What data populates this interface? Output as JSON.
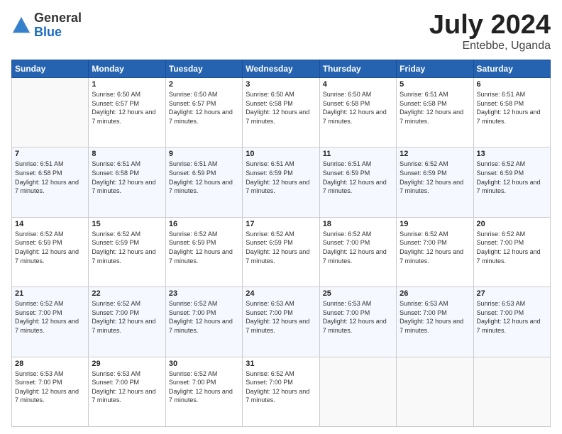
{
  "logo": {
    "general": "General",
    "blue": "Blue"
  },
  "header": {
    "month": "July 2024",
    "location": "Entebbe, Uganda"
  },
  "weekdays": [
    "Sunday",
    "Monday",
    "Tuesday",
    "Wednesday",
    "Thursday",
    "Friday",
    "Saturday"
  ],
  "weeks": [
    [
      {
        "day": "",
        "sunrise": "",
        "sunset": "",
        "daylight": ""
      },
      {
        "day": "1",
        "sunrise": "Sunrise: 6:50 AM",
        "sunset": "Sunset: 6:57 PM",
        "daylight": "Daylight: 12 hours and 7 minutes."
      },
      {
        "day": "2",
        "sunrise": "Sunrise: 6:50 AM",
        "sunset": "Sunset: 6:57 PM",
        "daylight": "Daylight: 12 hours and 7 minutes."
      },
      {
        "day": "3",
        "sunrise": "Sunrise: 6:50 AM",
        "sunset": "Sunset: 6:58 PM",
        "daylight": "Daylight: 12 hours and 7 minutes."
      },
      {
        "day": "4",
        "sunrise": "Sunrise: 6:50 AM",
        "sunset": "Sunset: 6:58 PM",
        "daylight": "Daylight: 12 hours and 7 minutes."
      },
      {
        "day": "5",
        "sunrise": "Sunrise: 6:51 AM",
        "sunset": "Sunset: 6:58 PM",
        "daylight": "Daylight: 12 hours and 7 minutes."
      },
      {
        "day": "6",
        "sunrise": "Sunrise: 6:51 AM",
        "sunset": "Sunset: 6:58 PM",
        "daylight": "Daylight: 12 hours and 7 minutes."
      }
    ],
    [
      {
        "day": "7",
        "sunrise": "Sunrise: 6:51 AM",
        "sunset": "Sunset: 6:58 PM",
        "daylight": "Daylight: 12 hours and 7 minutes."
      },
      {
        "day": "8",
        "sunrise": "Sunrise: 6:51 AM",
        "sunset": "Sunset: 6:58 PM",
        "daylight": "Daylight: 12 hours and 7 minutes."
      },
      {
        "day": "9",
        "sunrise": "Sunrise: 6:51 AM",
        "sunset": "Sunset: 6:59 PM",
        "daylight": "Daylight: 12 hours and 7 minutes."
      },
      {
        "day": "10",
        "sunrise": "Sunrise: 6:51 AM",
        "sunset": "Sunset: 6:59 PM",
        "daylight": "Daylight: 12 hours and 7 minutes."
      },
      {
        "day": "11",
        "sunrise": "Sunrise: 6:51 AM",
        "sunset": "Sunset: 6:59 PM",
        "daylight": "Daylight: 12 hours and 7 minutes."
      },
      {
        "day": "12",
        "sunrise": "Sunrise: 6:52 AM",
        "sunset": "Sunset: 6:59 PM",
        "daylight": "Daylight: 12 hours and 7 minutes."
      },
      {
        "day": "13",
        "sunrise": "Sunrise: 6:52 AM",
        "sunset": "Sunset: 6:59 PM",
        "daylight": "Daylight: 12 hours and 7 minutes."
      }
    ],
    [
      {
        "day": "14",
        "sunrise": "Sunrise: 6:52 AM",
        "sunset": "Sunset: 6:59 PM",
        "daylight": "Daylight: 12 hours and 7 minutes."
      },
      {
        "day": "15",
        "sunrise": "Sunrise: 6:52 AM",
        "sunset": "Sunset: 6:59 PM",
        "daylight": "Daylight: 12 hours and 7 minutes."
      },
      {
        "day": "16",
        "sunrise": "Sunrise: 6:52 AM",
        "sunset": "Sunset: 6:59 PM",
        "daylight": "Daylight: 12 hours and 7 minutes."
      },
      {
        "day": "17",
        "sunrise": "Sunrise: 6:52 AM",
        "sunset": "Sunset: 6:59 PM",
        "daylight": "Daylight: 12 hours and 7 minutes."
      },
      {
        "day": "18",
        "sunrise": "Sunrise: 6:52 AM",
        "sunset": "Sunset: 7:00 PM",
        "daylight": "Daylight: 12 hours and 7 minutes."
      },
      {
        "day": "19",
        "sunrise": "Sunrise: 6:52 AM",
        "sunset": "Sunset: 7:00 PM",
        "daylight": "Daylight: 12 hours and 7 minutes."
      },
      {
        "day": "20",
        "sunrise": "Sunrise: 6:52 AM",
        "sunset": "Sunset: 7:00 PM",
        "daylight": "Daylight: 12 hours and 7 minutes."
      }
    ],
    [
      {
        "day": "21",
        "sunrise": "Sunrise: 6:52 AM",
        "sunset": "Sunset: 7:00 PM",
        "daylight": "Daylight: 12 hours and 7 minutes."
      },
      {
        "day": "22",
        "sunrise": "Sunrise: 6:52 AM",
        "sunset": "Sunset: 7:00 PM",
        "daylight": "Daylight: 12 hours and 7 minutes."
      },
      {
        "day": "23",
        "sunrise": "Sunrise: 6:52 AM",
        "sunset": "Sunset: 7:00 PM",
        "daylight": "Daylight: 12 hours and 7 minutes."
      },
      {
        "day": "24",
        "sunrise": "Sunrise: 6:53 AM",
        "sunset": "Sunset: 7:00 PM",
        "daylight": "Daylight: 12 hours and 7 minutes."
      },
      {
        "day": "25",
        "sunrise": "Sunrise: 6:53 AM",
        "sunset": "Sunset: 7:00 PM",
        "daylight": "Daylight: 12 hours and 7 minutes."
      },
      {
        "day": "26",
        "sunrise": "Sunrise: 6:53 AM",
        "sunset": "Sunset: 7:00 PM",
        "daylight": "Daylight: 12 hours and 7 minutes."
      },
      {
        "day": "27",
        "sunrise": "Sunrise: 6:53 AM",
        "sunset": "Sunset: 7:00 PM",
        "daylight": "Daylight: 12 hours and 7 minutes."
      }
    ],
    [
      {
        "day": "28",
        "sunrise": "Sunrise: 6:53 AM",
        "sunset": "Sunset: 7:00 PM",
        "daylight": "Daylight: 12 hours and 7 minutes."
      },
      {
        "day": "29",
        "sunrise": "Sunrise: 6:53 AM",
        "sunset": "Sunset: 7:00 PM",
        "daylight": "Daylight: 12 hours and 7 minutes."
      },
      {
        "day": "30",
        "sunrise": "Sunrise: 6:52 AM",
        "sunset": "Sunset: 7:00 PM",
        "daylight": "Daylight: 12 hours and 7 minutes."
      },
      {
        "day": "31",
        "sunrise": "Sunrise: 6:52 AM",
        "sunset": "Sunset: 7:00 PM",
        "daylight": "Daylight: 12 hours and 7 minutes."
      },
      {
        "day": "",
        "sunrise": "",
        "sunset": "",
        "daylight": ""
      },
      {
        "day": "",
        "sunrise": "",
        "sunset": "",
        "daylight": ""
      },
      {
        "day": "",
        "sunrise": "",
        "sunset": "",
        "daylight": ""
      }
    ]
  ]
}
